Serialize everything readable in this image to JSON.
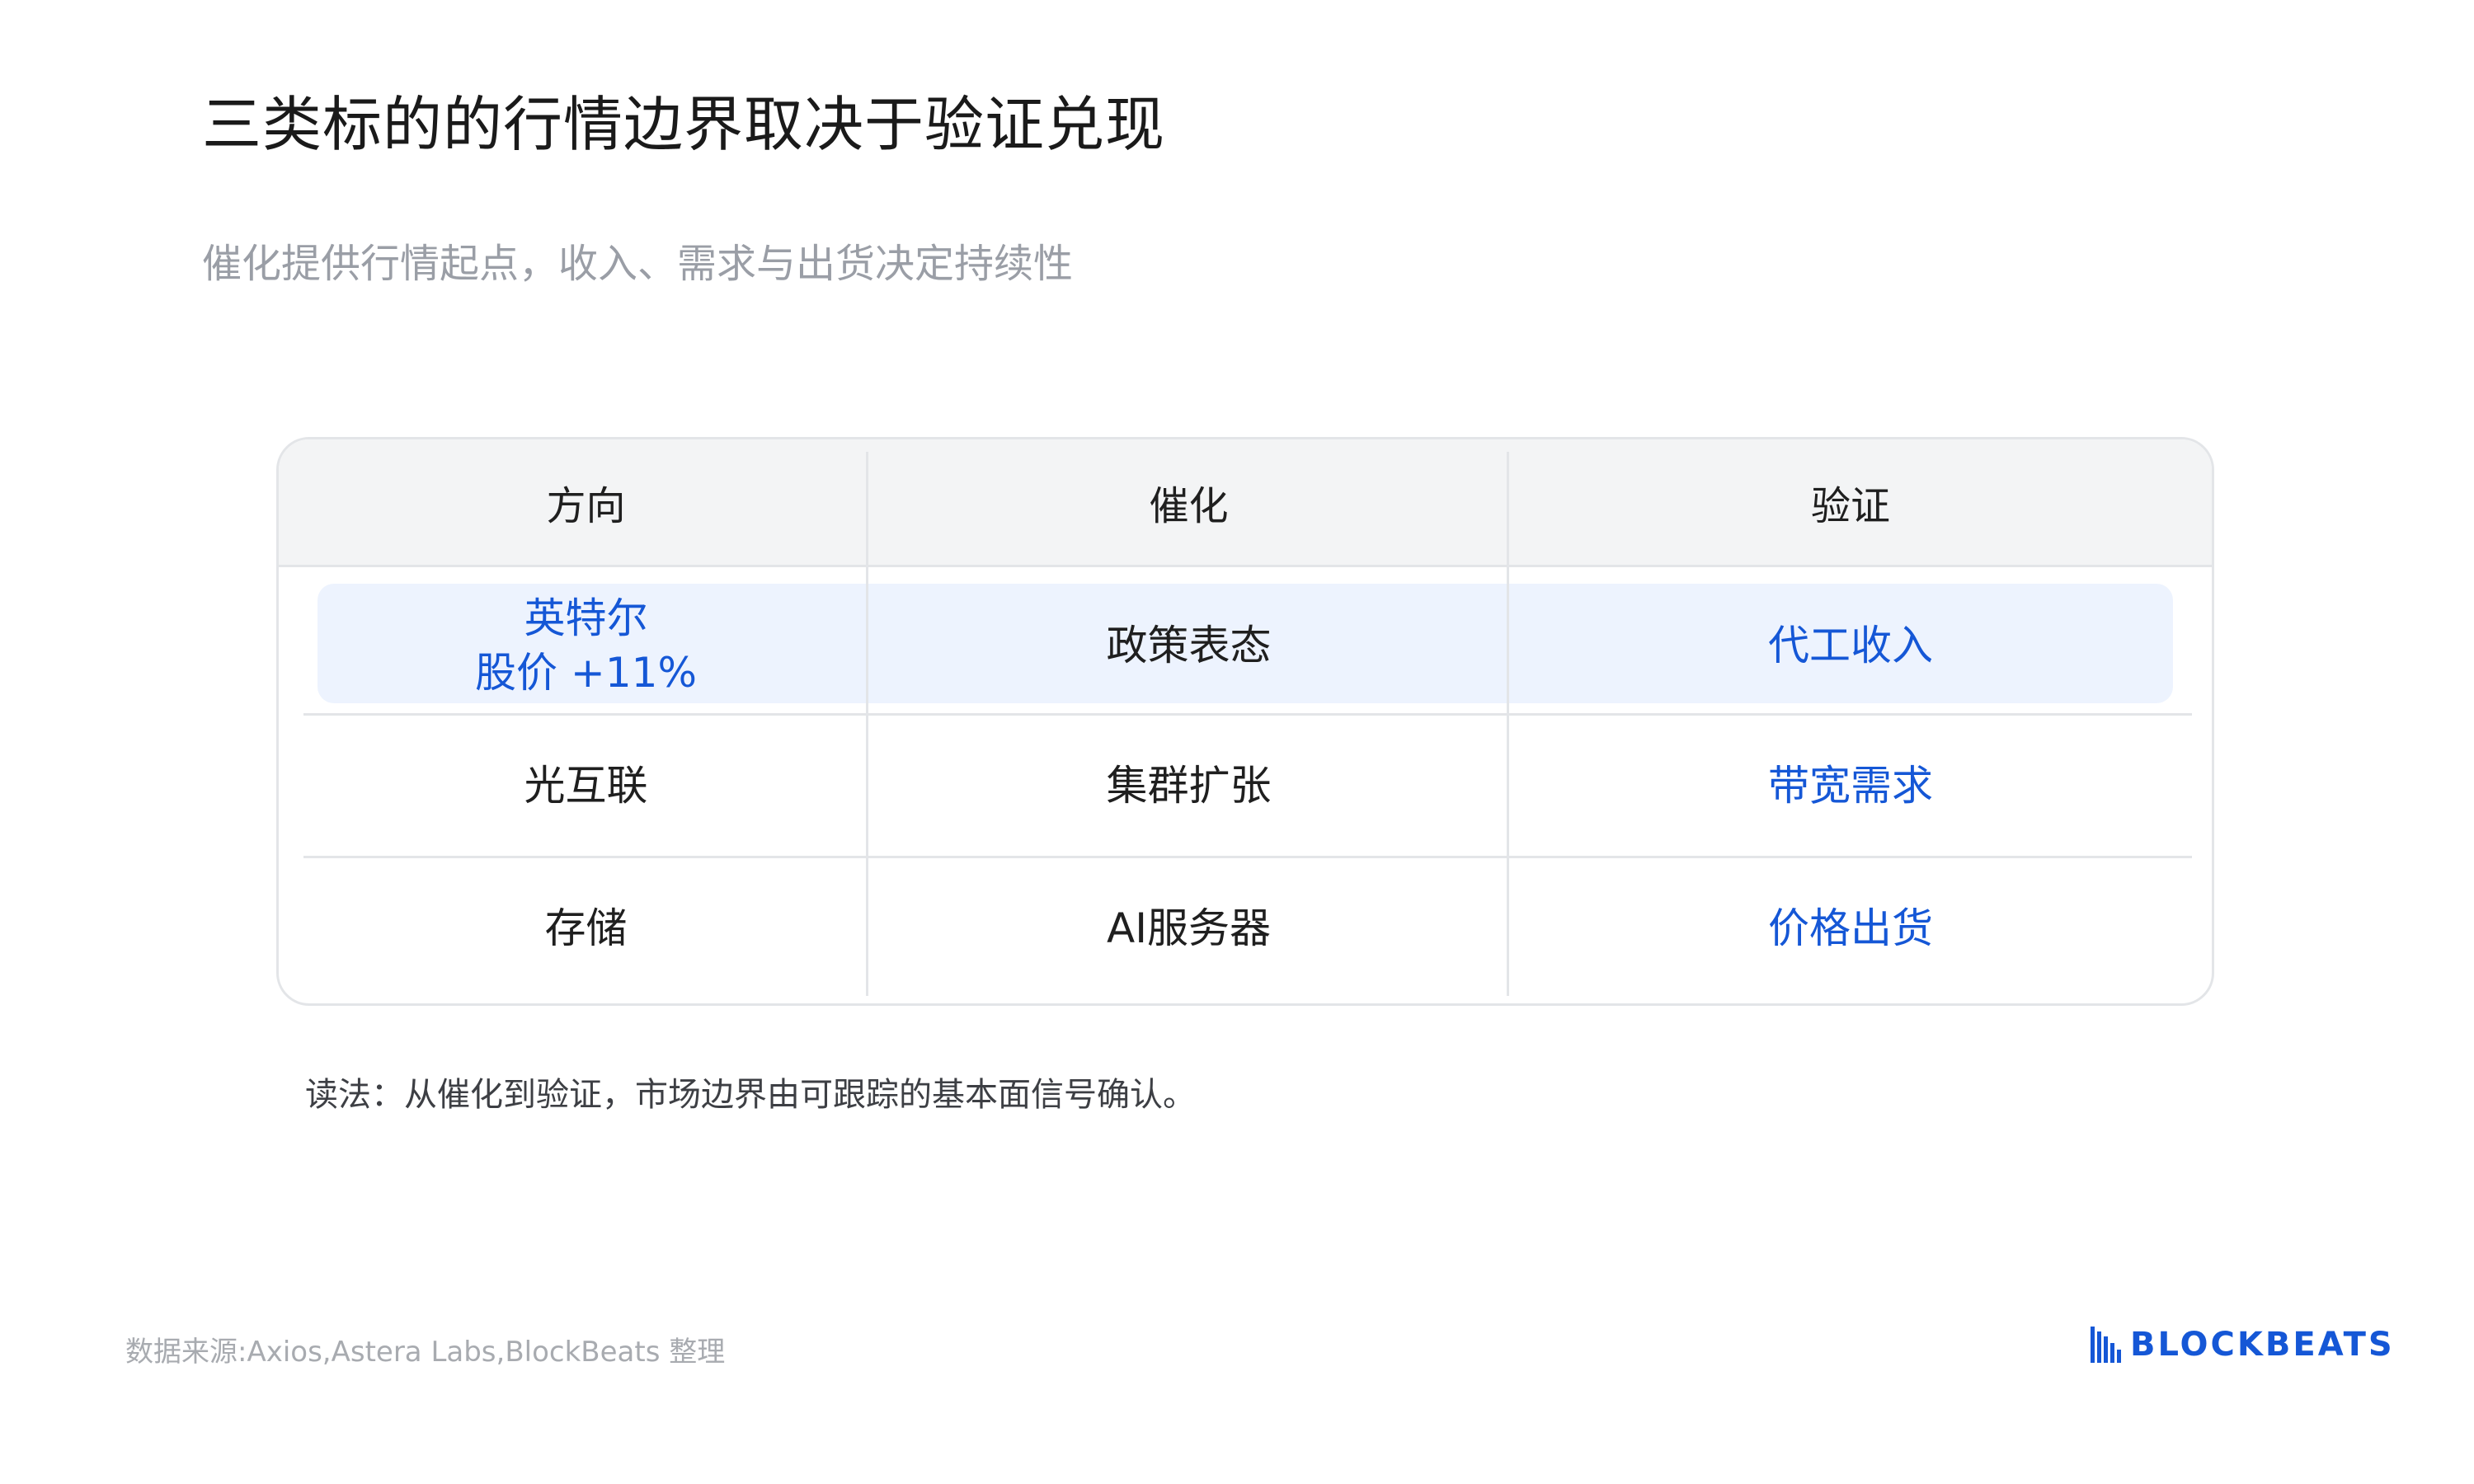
{
  "header": {
    "title": "三类标的的行情边界取决于验证兑现",
    "subtitle": "催化提供行情起点，收入、需求与出货决定持续性"
  },
  "table": {
    "columns": [
      "方向",
      "催化",
      "验证"
    ],
    "rows": [
      {
        "direction_line1": "英特尔",
        "direction_line2": "股价 +11%",
        "catalyst": "政策表态",
        "verification": "代工收入"
      },
      {
        "direction": "光互联",
        "catalyst": "集群扩张",
        "verification": "带宽需求"
      },
      {
        "direction": "存储",
        "catalyst": "AI服务器",
        "verification": "价格出货"
      }
    ]
  },
  "note": "读法：从催化到验证，市场边界由可跟踪的基本面信号确认。",
  "footer": {
    "source": "数据来源:Axios,Astera Labs,BlockBeats 整理",
    "logo_text": "BLOCKBEATS"
  },
  "colors": {
    "accent": "#1557d6",
    "highlight_row": "#edf3fe",
    "header_bg": "#f3f4f5"
  }
}
